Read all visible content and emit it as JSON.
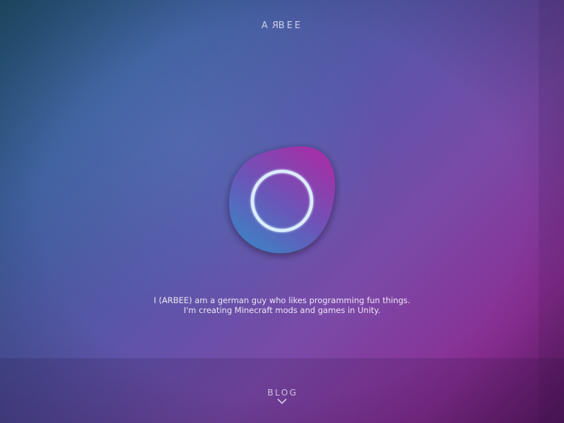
{
  "brand": {
    "prefix": "A",
    "flipped_letter": "R",
    "suffix": "BEE"
  },
  "hero": {
    "icon": "ring-icon",
    "colors": {
      "blob_top": "#a52fa6",
      "blob_bottom": "#3f7fc4",
      "ring": "#dbeeff"
    }
  },
  "bio": {
    "line1": "I (ARBEE) am a german guy who likes programming fun things.",
    "line2": "I'm creating Minecraft mods and games in Unity."
  },
  "nav": {
    "blog_label": "BLOG",
    "blog_icon": "chevron-down-icon"
  }
}
